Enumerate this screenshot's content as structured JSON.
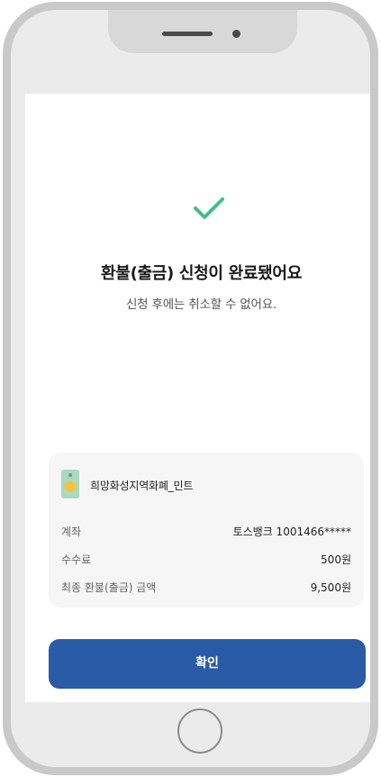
{
  "status": {
    "title": "환불(출금) 신청이 완료됐어요",
    "subtitle": "신청 후에는 취소할 수 없어요."
  },
  "card": {
    "name": "희망화성지역화폐_민트",
    "rows": [
      {
        "label": "계좌",
        "value": "토스뱅크 1001466*****"
      },
      {
        "label": "수수료",
        "value": "500원"
      },
      {
        "label": "최종 환불(출금) 금액",
        "value": "9,500원"
      }
    ]
  },
  "actions": {
    "confirm_label": "확인"
  },
  "colors": {
    "accent": "#2a5ba6",
    "success": "#3fbf86"
  },
  "icons": {
    "status": "check-icon",
    "card": "card-thumbnail-icon"
  }
}
